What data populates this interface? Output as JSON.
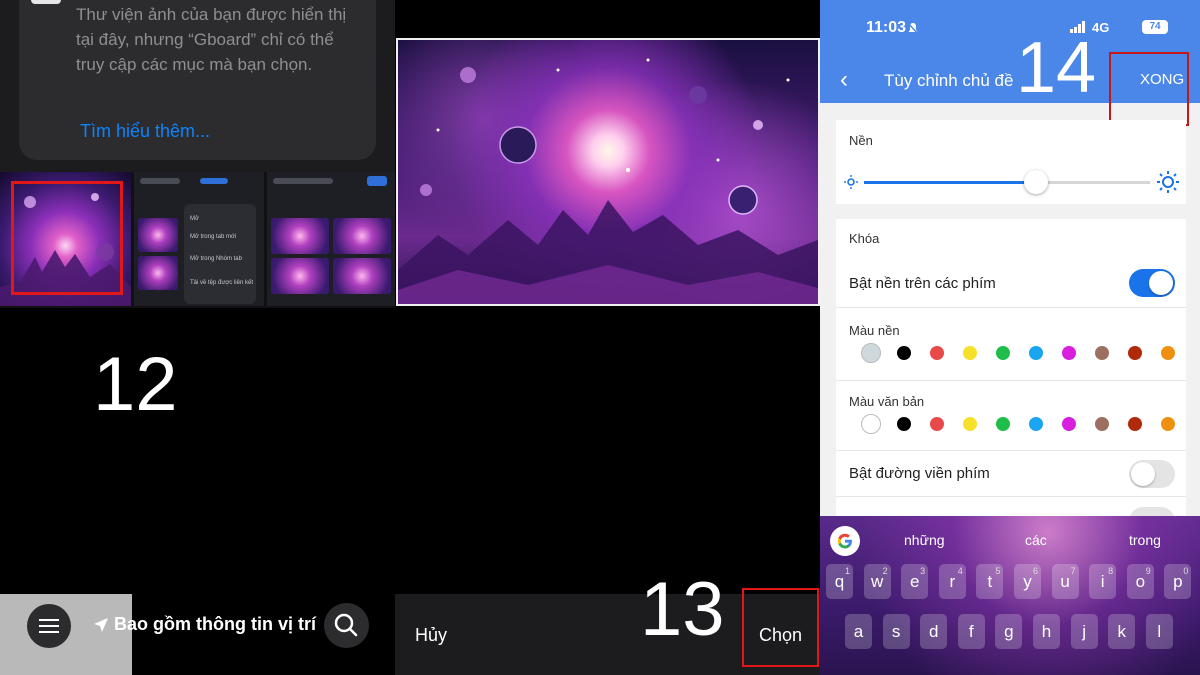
{
  "panel1": {
    "info_text": "Thư viện ảnh của bạn được hiển thị tại đây, nhưng “Gboard” chỉ có thể truy cập các mục mà bạn chọn.",
    "learn_more": "Tìm hiểu thêm...",
    "step_number": "12",
    "location_label": "Bao gồm thông tin vị trí",
    "context_menu": [
      "Mở",
      "Mở trong tab mới",
      "Mở trong Nhóm tab",
      "Tải về tệp được liên kết"
    ],
    "icons": [
      "menu-icon",
      "location-arrow-icon",
      "search-icon"
    ]
  },
  "panel2": {
    "cancel_label": "Hủy",
    "choose_label": "Chọn",
    "step_number": "13"
  },
  "panel3": {
    "status_time": "11:03",
    "network": "4G",
    "battery": "74",
    "title": "Tùy chỉnh chủ đề",
    "done_label": "XONG",
    "step_number": "14",
    "background_section": "Nền",
    "background_level": 0.6,
    "lock_section": "Khóa",
    "key_background_label": "Bật nền trên các phím",
    "key_background_on": true,
    "key_color_label": "Màu nền",
    "text_color_label": "Màu văn bản",
    "key_border_label": "Bật đường viền phím",
    "key_border_on": false,
    "key_color_swatches": [
      "#cfd8dc",
      "#000000",
      "#e84a4a",
      "#f5e12a",
      "#1fbe4a",
      "#1aa5f0",
      "#d81fe0",
      "#9c7060",
      "#b02a0a",
      "#f09010"
    ],
    "text_color_swatches": [
      "#ffffff",
      "#000000",
      "#e84a4a",
      "#f5e12a",
      "#1fbe4a",
      "#1aa5f0",
      "#d81fe0",
      "#9c7060",
      "#b02a0a",
      "#f09010"
    ],
    "suggestions": [
      "những",
      "các",
      "trong"
    ],
    "keyboard_row1": [
      "q",
      "w",
      "e",
      "r",
      "t",
      "y",
      "u",
      "i",
      "o",
      "p"
    ],
    "keyboard_row1_hints": [
      "1",
      "2",
      "3",
      "4",
      "5",
      "6",
      "7",
      "8",
      "9",
      "0"
    ],
    "keyboard_row2": [
      "a",
      "s",
      "d",
      "f",
      "g",
      "h",
      "j",
      "k",
      "l"
    ]
  },
  "colors": {
    "highlight": "#e01818",
    "header_blue": "#4a87e8",
    "toggle_blue": "#1a73e8",
    "link_blue": "#0a84ff"
  }
}
